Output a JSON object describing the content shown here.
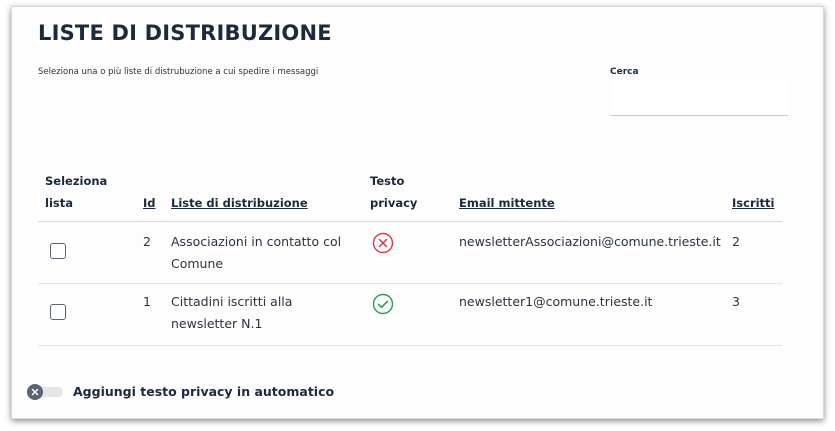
{
  "page": {
    "title": "LISTE DI DISTRIBUZIONE",
    "subtitle": "Seleziona una o più liste di distrubuzione a cui spedire i messaggi"
  },
  "search": {
    "label": "Cerca",
    "value": "",
    "placeholder": ""
  },
  "table": {
    "headers": {
      "select_line1": "Seleziona",
      "select_line2": "lista",
      "id": "Id",
      "list_name": "Liste di distribuzione",
      "privacy_line1": "Testo",
      "privacy_line2": "privacy",
      "email": "Email mittente",
      "subscribers": "Iscritti"
    },
    "rows": [
      {
        "id": "2",
        "name_line1": "Associazioni in contatto col",
        "name_line2": "Comune",
        "privacy_icon": "x-circle-icon",
        "email": "newsletterAssociazioni@comune.trieste.it",
        "subscribers": "2",
        "selected": false
      },
      {
        "id": "1",
        "name_line1": "Cittadini iscritti alla",
        "name_line2": "newsletter N.1",
        "privacy_icon": "check-circle-icon",
        "email": "newsletter1@comune.trieste.it",
        "subscribers": "3",
        "selected": false
      }
    ]
  },
  "toggle": {
    "label": "Aggiungi testo privacy in automatico",
    "enabled": false
  },
  "colors": {
    "privacy_no": "#d9364c",
    "privacy_yes": "#1f9e55",
    "toggle_knob": "#596473"
  }
}
